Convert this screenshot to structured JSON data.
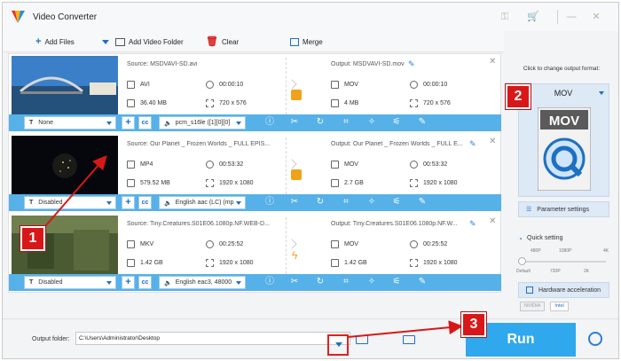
{
  "app": {
    "title": "Video Converter"
  },
  "toolbar": {
    "add_files": "Add Files",
    "add_video_folder": "Add Video Folder",
    "clear": "Clear",
    "merge": "Merge"
  },
  "files": [
    {
      "source": "Source: MSDVAVI-SD.avi",
      "src_format": "AVI",
      "src_duration": "00:00:10",
      "src_size": "36.40 MB",
      "src_resolution": "720 x 576",
      "output": "Output: MSDVAVI-SD.mov",
      "out_format": "MOV",
      "out_duration": "00:00:10",
      "out_size": "4 MB",
      "out_resolution": "720 x 576",
      "subtitle": "None",
      "audio": "pcm_s16le ([1][0][0]"
    },
    {
      "source": "Source: Our Planet _ Frozen Worlds _ FULL EPIS...",
      "src_format": "MP4",
      "src_duration": "00:53:32",
      "src_size": "579.52 MB",
      "src_resolution": "1920 x 1080",
      "output": "Output: Our Planet _ Frozen Worlds _ FULL E...",
      "out_format": "MOV",
      "out_duration": "00:53:32",
      "out_size": "2.7 GB",
      "out_resolution": "1920 x 1080",
      "subtitle": "Disabled",
      "audio": "English aac (LC) (mp"
    },
    {
      "source": "Source: Tiny.Creatures.S01E06.1080p.NF.WEB-D...",
      "src_format": "MKV",
      "src_duration": "00:25:52",
      "src_size": "1.42 GB",
      "src_resolution": "1920 x 1080",
      "output": "Output: Tiny.Creatures.S01E06.1080p.NF.W...",
      "out_format": "MOV",
      "out_duration": "00:25:52",
      "out_size": "1.42 GB",
      "out_resolution": "1920 x 1080",
      "subtitle": "Disabled",
      "audio": "English eac3, 48000"
    }
  ],
  "output_format": {
    "hint": "Click to change output format:",
    "name": "MOV",
    "icon_text": "MOV"
  },
  "parameter_settings": "Parameter settings",
  "quick_setting": {
    "label": "Quick setting",
    "top_ticks": [
      "480P",
      "1080P",
      "4K"
    ],
    "bottom_ticks": [
      "Default",
      "720P",
      "2K"
    ]
  },
  "hardware_acceleration": {
    "label": "Hardware acceleration",
    "nvidia": "NVIDIA",
    "intel": "Intel"
  },
  "output_folder": {
    "label": "Output folder:",
    "path": "C:\\Users\\Administrator\\Desktop"
  },
  "run_label": "Run",
  "annotations": {
    "one": "1",
    "two": "2",
    "three": "3"
  },
  "colors": {
    "accent": "#2fa8ee",
    "bar": "#56b1e8",
    "annotation": "#d81818",
    "gpu": "#f0a21b"
  }
}
